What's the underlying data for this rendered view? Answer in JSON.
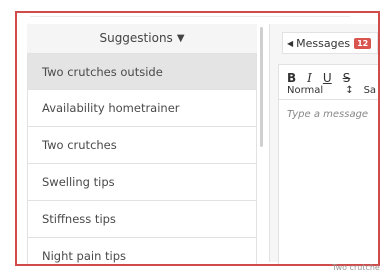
{
  "suggestions": {
    "title": "Suggestions",
    "items": [
      {
        "label": "Two crutches outside",
        "active": true
      },
      {
        "label": "Availability hometrainer",
        "active": false
      },
      {
        "label": "Two crutches",
        "active": false
      },
      {
        "label": "Swelling tips",
        "active": false
      },
      {
        "label": "Stiffness tips",
        "active": false
      },
      {
        "label": "Night pain tips",
        "active": false
      }
    ]
  },
  "messages": {
    "label": "Messages",
    "count": "12",
    "toolbar": {
      "bold": "B",
      "italic": "I",
      "underline": "U",
      "strike": "S",
      "block_format": "Normal",
      "block_arrow": "↕",
      "font": "Sa"
    },
    "placeholder": "Type a message"
  },
  "footer_text": "Two crutche",
  "colors": {
    "frame": "#d14b4b",
    "badge": "#d9534f",
    "active_item": "#e4e4e4"
  }
}
